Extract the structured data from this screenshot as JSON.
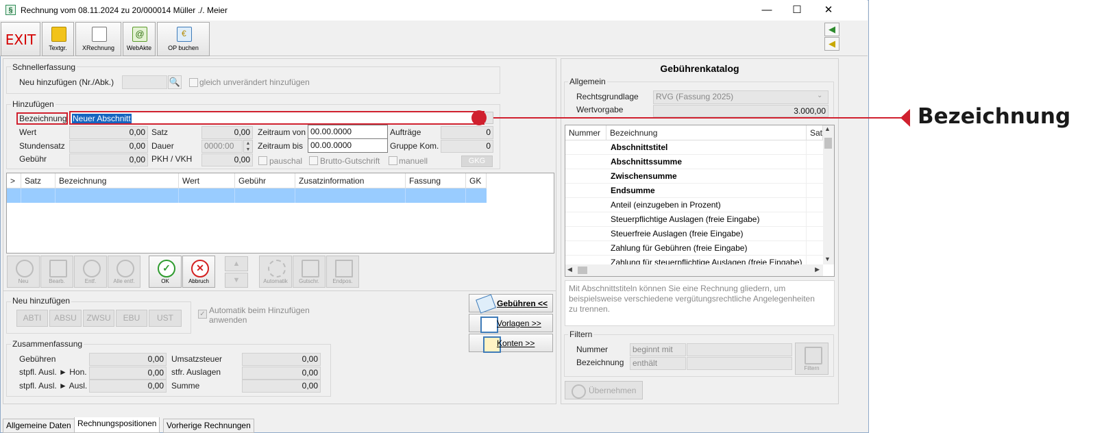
{
  "window": {
    "title": "Rechnung vom 08.11.2024 zu 20/000014  Müller ./. Meier",
    "app_icon_glyph": "§",
    "minimize": "—",
    "maximize": "☐",
    "close": "✕"
  },
  "toolbar": {
    "exit": "EXIT",
    "textgr": "Textgr.",
    "xrechnung": "XRechnung",
    "webakte": "WebAkte",
    "op_buchen": "OP buchen"
  },
  "schnellerfassung": {
    "title": "Schnellerfassung",
    "neu_label": "Neu hinzufügen (Nr./Abk.)",
    "neu_value": "",
    "gleich_label": "gleich unverändert hinzufügen"
  },
  "hinzufuegen": {
    "title": "Hinzufügen",
    "bezeichnung_label": "Bezeichnung",
    "bezeichnung_value": "Neuer Abschnitt",
    "wert_label": "Wert",
    "wert_value": "0,00",
    "satz_label": "Satz",
    "satz_value": "0,00",
    "zeitraum_von_label": "Zeitraum von",
    "zeitraum_von_value": "00.00.0000",
    "auftraege_label": "Aufträge",
    "auftraege_value": "0",
    "stundensatz_label": "Stundensatz",
    "stundensatz_value": "0,00",
    "dauer_label": "Dauer",
    "dauer_value": "0000:00",
    "zeitraum_bis_label": "Zeitraum bis",
    "zeitraum_bis_value": "00.00.0000",
    "gruppe_label": "Gruppe Kom.",
    "gruppe_value": "0",
    "gebuehr_label": "Gebühr",
    "gebuehr_value": "0,00",
    "pkh_label": "PKH / VKH",
    "pkh_value": "0,00",
    "pauschal_label": "pauschal",
    "brutto_label": "Brutto-Gutschrift",
    "manuell_label": "manuell",
    "gkg_label": "GKG"
  },
  "positions_grid": {
    "columns": [
      ">",
      "Satz",
      "Bezeichnung",
      "Wert",
      "Gebühr",
      "Zusatzinformation",
      "Fassung",
      "GK"
    ]
  },
  "actions": {
    "neu": "Neu",
    "bearb": "Bearb.",
    "entf": "Entf.",
    "alle_entf": "Alle entf.",
    "ok": "OK",
    "abbruch": "Abbruch",
    "automatik": "Automatik",
    "gutschr": "Gutschr.",
    "endpos": "Endpos."
  },
  "neu_hinzufuegen": {
    "title": "Neu hinzufügen",
    "buttons": [
      "ABTI",
      "ABSU",
      "ZWSU",
      "EBU",
      "UST"
    ],
    "automatik_label_1": "Automatik beim Hinzufügen",
    "automatik_label_2": "anwenden"
  },
  "side_buttons": {
    "gebuehren": "Gebühren <<",
    "vorlagen": "Vorlagen >>",
    "konten": "Konten >>"
  },
  "zusammenfassung": {
    "title": "Zusammenfassung",
    "gebuehren_label": "Gebühren",
    "gebuehren_value": "0,00",
    "umsatzsteuer_label": "Umsatzsteuer",
    "umsatzsteuer_value": "0,00",
    "stpfl_hon_label": "stpfl. Ausl. ► Hon.",
    "stpfl_hon_value": "0,00",
    "stfr_label": "stfr. Auslagen",
    "stfr_value": "0,00",
    "stpfl_ausl_label": "stpfl. Ausl. ► Ausl.",
    "stpfl_ausl_value": "0,00",
    "summe_label": "Summe",
    "summe_value": "0,00"
  },
  "tabs": [
    "Allgemeine Daten",
    "Rechnungspositionen",
    "Vorherige Rechnungen"
  ],
  "katalog": {
    "title": "Gebührenkatalog",
    "allgemein_title": "Allgemein",
    "rechtsgrundlage_label": "Rechtsgrundlage",
    "rechtsgrundlage_value": "RVG (Fassung 2025)",
    "wertvorgabe_label": "Wertvorgabe",
    "wertvorgabe_value": "3.000,00",
    "columns": [
      "Nummer",
      "Bezeichnung",
      "Sat"
    ],
    "rows": [
      {
        "label": "Abschnittstitel",
        "bold": true
      },
      {
        "label": "Abschnittssumme",
        "bold": true
      },
      {
        "label": "Zwischensumme",
        "bold": true
      },
      {
        "label": "Endsumme",
        "bold": true
      },
      {
        "label": "Anteil (einzugeben in Prozent)",
        "bold": false
      },
      {
        "label": "Steuerpflichtige Auslagen (freie Eingabe)",
        "bold": false
      },
      {
        "label": "Steuerfreie Auslagen (freie Eingabe)",
        "bold": false
      },
      {
        "label": "Zahlung für Gebühren (freie Eingabe)",
        "bold": false
      },
      {
        "label": "Zahlung für steuerpflichtige Auslagen (freie Eingabe)",
        "bold": false
      }
    ],
    "description": "Mit Abschnittstiteln können Sie eine Rechnung gliedern, um beispielsweise verschiedene vergütungsrechtliche Angelegenheiten zu trennen.",
    "filter_title": "Filtern",
    "nummer_label": "Nummer",
    "nummer_mode": "beginnt mit",
    "bezeichnung_label": "Bezeichnung",
    "bezeichnung_mode": "enthält",
    "filtern_button": "Filtern",
    "uebernehmen_button": "Übernehmen"
  },
  "annotation": {
    "label": "Bezeichnung",
    "color": "#d0202e"
  }
}
